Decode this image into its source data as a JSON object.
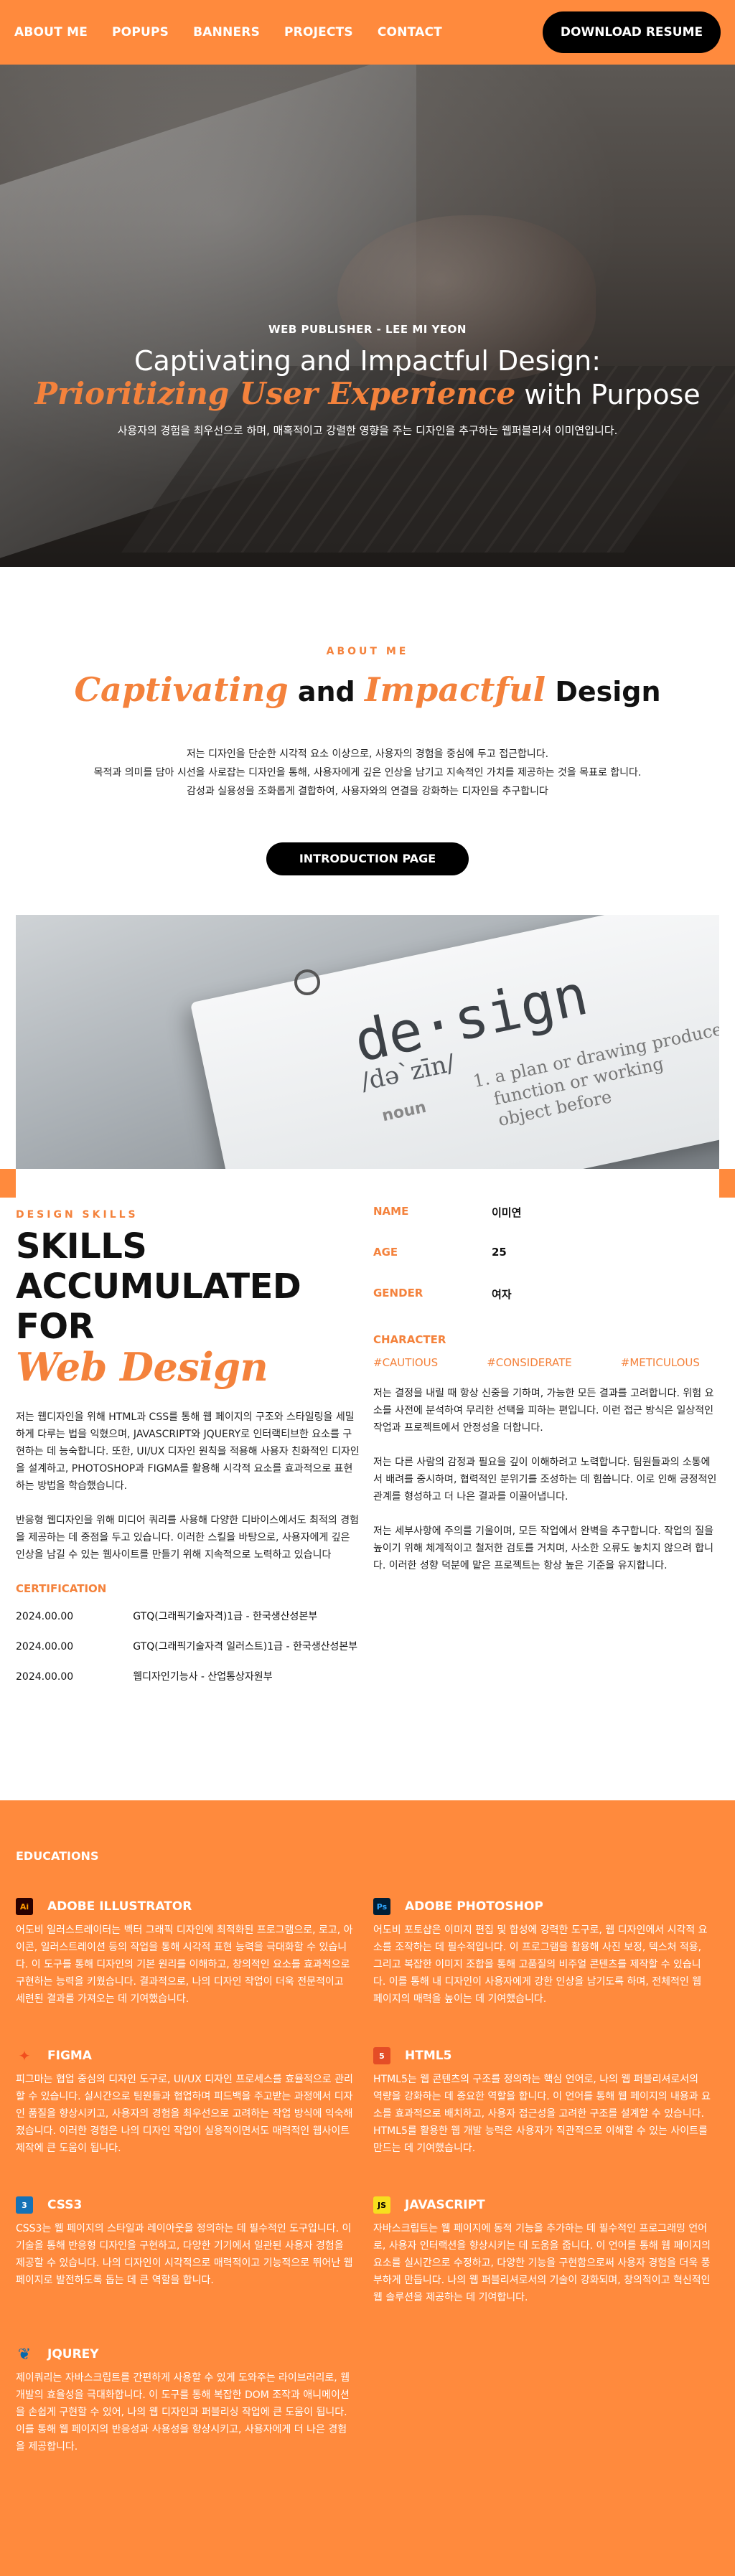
{
  "nav": {
    "items": [
      "ABOUT ME",
      "POPUPS",
      "BANNERS",
      "PROJECTS",
      "CONTACT"
    ],
    "download_label": "DOWNLOAD RESUME"
  },
  "hero": {
    "eyebrow": "WEB PUBLISHER - LEE MI YEON",
    "line1": "Captivating and Impactful Design:",
    "line2_italic": "Prioritizing User Experience",
    "line2_rest": " with Purpose",
    "desc": "사용자의 경험을 최우선으로 하며, 매혹적이고 강렬한 영향을 주는 디자인을 추구하는 웹퍼블리셔 이미연입니다."
  },
  "about": {
    "label": "ABOUT ME",
    "title_italic1": "Captivating",
    "title_and": " and ",
    "title_italic2": "Impactful",
    "title_rest": " Design",
    "paras": [
      "저는 디자인을 단순한 시각적 요소 이상으로, 사용자의 경험을 중심에 두고 접근합니다.",
      "목적과 의미를 담아 시선을 사로잡는 디자인을 통해, 사용자에게 깊은 인상을 남기고 지속적인 가치를 제공하는 것을 목표로 합니다.",
      "감성과 실용성을 조화롭게 결합하여, 사용자와의 연결을 강화하는 디자인을 추구합니다"
    ],
    "button": "INTRODUCTION PAGE"
  },
  "design_image": {
    "word": "de·sign",
    "pron": "/də`zīn/",
    "noun": "noun",
    "def": "1. a plan or drawing produce\n   function or working\n   object before"
  },
  "skills": {
    "label": "DESIGN SKILLS",
    "big_line1": "SKILLS",
    "big_line2": "ACCUMULATED",
    "big_line3": "FOR",
    "big_italic": "Web Design",
    "para1": "저는 웹디자인을 위해 HTML과 CSS를 통해 웹 페이지의 구조와 스타일링을 세밀하게 다루는 법을 익혔으며, JAVASCRIPT와 JQUERY로 인터랙티브한 요소를 구현하는 데 능숙합니다. 또한, UI/UX 디자인 원칙을 적용해 사용자 친화적인 디자인을 설계하고, PHOTOSHOP과 FIGMA를 활용해 시각적 요소를 효과적으로 표현하는 방법을 학습했습니다.",
    "para2": "반응형 웹디자인을 위해 미디어 쿼리를 사용해 다양한 디바이스에서도 최적의 경험을 제공하는 데 중점을 두고 있습니다. 이러한 스킬을 바탕으로, 사용자에게 깊은 인상을 남길 수 있는 웹사이트를 만들기 위해 지속적으로 노력하고 있습니다",
    "cert_title": "CERTIFICATION",
    "certs": [
      {
        "date": "2024.00.00",
        "name": "GTQ(그래픽기술자격)1급 - 한국생산성본부"
      },
      {
        "date": "2024.00.00",
        "name": "GTQ(그래픽기술자격 일러스트)1급 - 한국생산성본부"
      },
      {
        "date": "2024.00.00",
        "name": "웹디자인기능사 - 산업통상자원부"
      }
    ]
  },
  "profile": {
    "rows": [
      {
        "key": "NAME",
        "value": "이미연"
      },
      {
        "key": "AGE",
        "value": "25"
      },
      {
        "key": "GENDER",
        "value": "여자"
      }
    ],
    "char_title": "CHARACTER",
    "tags": [
      "#CAUTIOUS",
      "#CONSIDERATE",
      "#METICULOUS"
    ],
    "paras": [
      "저는 결정을 내릴 때 항상 신중을 기하며, 가능한 모든 결과를 고려합니다. 위험 요소를 사전에 분석하여 무리한 선택을 피하는 편입니다. 이런 접근 방식은 일상적인 작업과 프로젝트에서 안정성을 더합니다.",
      "저는 다른 사람의 감정과 필요을 깊이 이해하려고 노력합니다. 팀원들과의 소통에서 배려를 중시하며, 협력적인 분위기를 조성하는 데 힘씁니다. 이로 인해 긍정적인 관계를 형성하고 더 나은 결과를 이끌어냅니다.",
      "저는 세부사항에 주의를 기울이며, 모든 작업에서 완벽을 추구합니다. 작업의 질을 높이기 위해 체계적이고 철저한 검토를 거치며, 사소한 오류도 놓치지 않으려 합니다. 이러한 성향 덕분에 맡은 프로젝트는 항상 높은 기준을 유지합니다."
    ]
  },
  "educations": {
    "title": "EDUCATIONS",
    "items": [
      {
        "icon": "Ai",
        "name": "ADOBE ILLUSTRATOR",
        "text": "어도비 일러스트레이터는 벡터 그래픽 디자인에 최적화된 프로그램으로, 로고, 아이콘, 일러스트레이션 등의 작업을 통해 시각적 표현 능력을 극대화할 수 있습니다. 이 도구를 통해 디자인의 기본 원리를 이해하고, 창의적인 요소를 효과적으로 구현하는 능력을 키웠습니다. 결과적으로, 나의 디자인 작업이 더욱 전문적이고 세련된 결과를 가져오는 데 기여했습니다."
      },
      {
        "icon": "Ps",
        "name": "ADOBE PHOTOSHOP",
        "text": "어도비 포토샵은 이미지 편집 및 합성에 강력한 도구로, 웹 디자인에서 시각적 요소를 조작하는 데 필수적입니다. 이 프로그램을 활용해 사진 보정, 텍스처 적용, 그리고 복잡한 이미지 조합을 통해 고품질의 비주얼 콘텐츠를 제작할 수 있습니다. 이를 통해 내 디자인이 사용자에게 강한 인상을 남기도록 하며, 전체적인 웹 페이지의 매력을 높이는 데 기여했습니다."
      },
      {
        "icon": "✦",
        "name": "FIGMA",
        "text": "피그마는 협업 중심의 디자인 도구로, UI/UX 디자인 프로세스를 효율적으로 관리할 수 있습니다. 실시간으로 팀원들과 협업하며 피드백을 주고받는 과정에서 디자인 품질을 향상시키고, 사용자의 경험을 최우선으로 고려하는 작업 방식에 익숙해졌습니다. 이러한 경험은 나의 디자인 작업이 실용적이면서도 매력적인 웹사이트 제작에 큰 도움이 됩니다."
      },
      {
        "icon": "5",
        "name": "HTML5",
        "text": "HTML5는 웹 콘텐츠의 구조를 정의하는 핵심 언어로, 나의 웹 퍼블리셔로서의 역량을 강화하는 데 중요한 역할을 합니다. 이 언어를 통해 웹 페이지의 내용과 요소를 효과적으로 배치하고, 사용자 접근성을 고려한 구조를 설계할 수 있습니다. HTML5를 활용한 웹 개발 능력은 사용자가 직관적으로 이해할 수 있는 사이트를 만드는 데 기여했습니다."
      },
      {
        "icon": "3",
        "name": "CSS3",
        "text": "CSS3는 웹 페이지의 스타일과 레이아웃을 정의하는 데 필수적인 도구입니다. 이 기술을 통해 반응형 디자인을 구현하고, 다양한 기기에서 일관된 사용자 경험을 제공할 수 있습니다. 나의 디자인이 시각적으로 매력적이고 기능적으로 뛰어난 웹 페이지로 발전하도록 돕는 데 큰 역할을 합니다."
      },
      {
        "icon": "JS",
        "name": "JAVASCRIPT",
        "text": "자바스크립트는 웹 페이지에 동적 기능을 추가하는 데 필수적인 프로그래밍 언어로, 사용자 인터랙션을 향상시키는 데 도움을 줍니다. 이 언어를 통해 웹 페이지의 요소를 실시간으로 수정하고, 다양한 기능을 구현함으로써 사용자 경험을 더욱 풍부하게 만듭니다. 나의 웹 퍼블리셔로서의 기술이 강화되며, 창의적이고 혁신적인 웹 솔루션을 제공하는 데 기여합니다."
      },
      {
        "icon": "❦",
        "name": "JQUREY",
        "text": "제이쿼리는 자바스크립트를 간편하게 사용할 수 있게 도와주는 라이브러리로, 웹 개발의 효율성을 극대화합니다. 이 도구를 통해 복잡한 DOM 조작과 애니메이션을 손쉽게 구현할 수 있어, 나의 웹 디자인과 퍼블리싱 작업에 큰 도움이 됩니다. 이를 통해 웹 페이지의 반응성과 사용성을 향상시키고, 사용자에게 더 나은 경험을 제공합니다."
      }
    ]
  }
}
